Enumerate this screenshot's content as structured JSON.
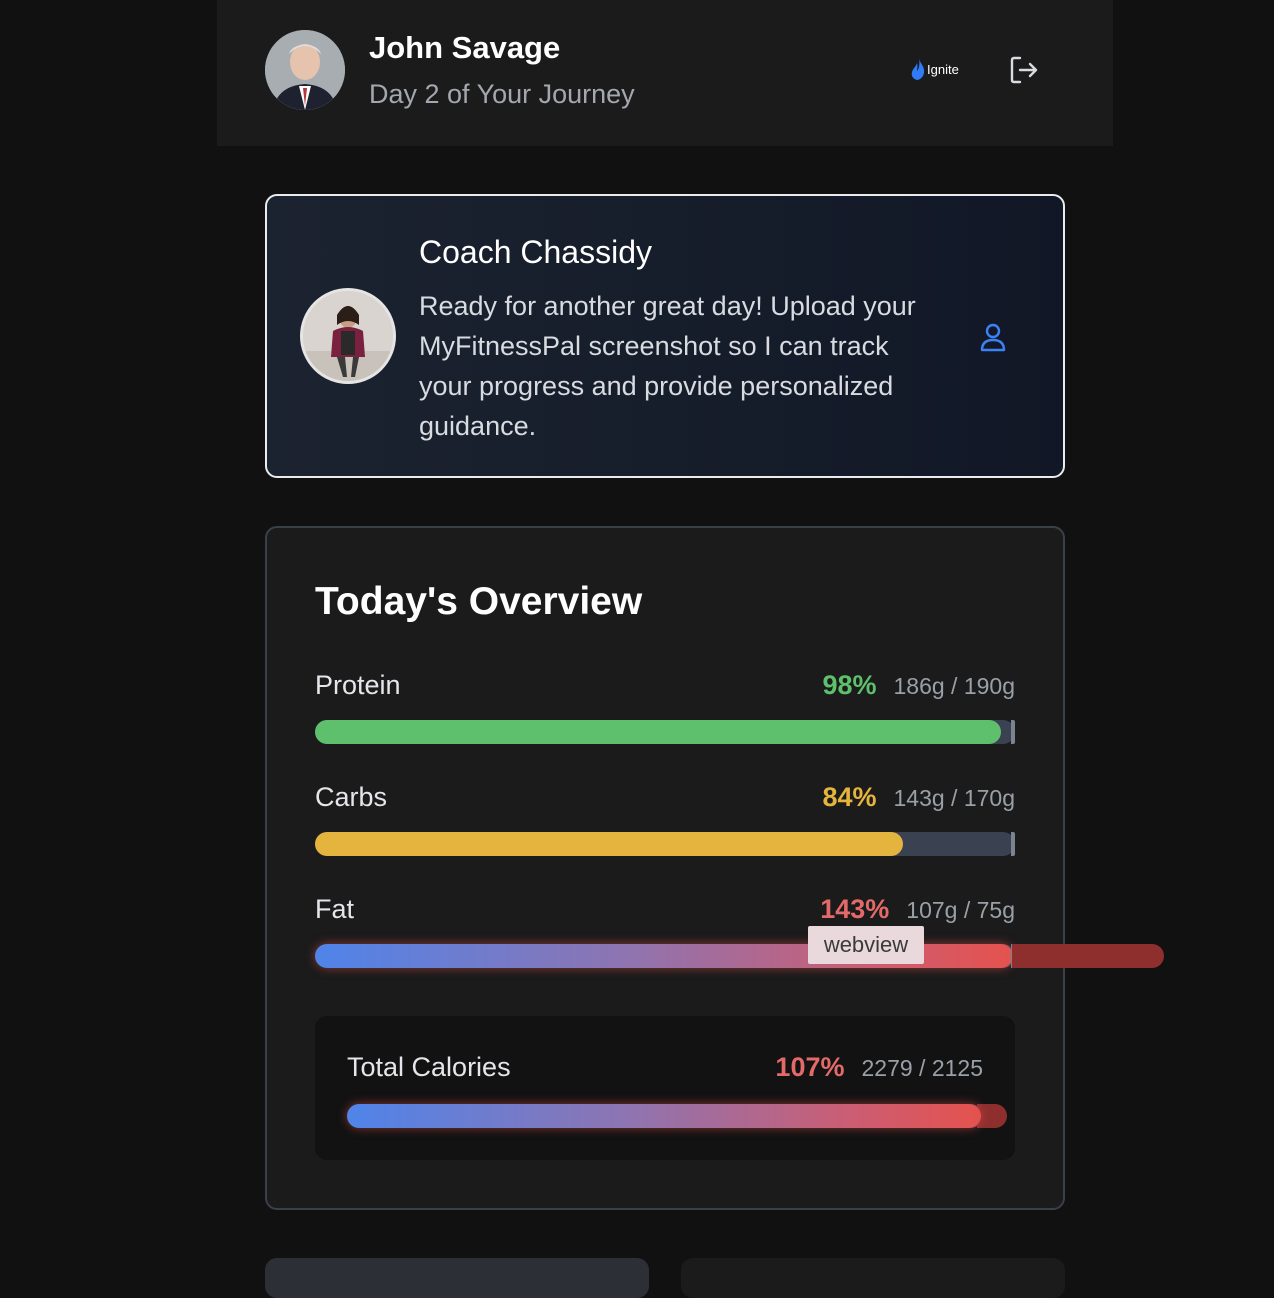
{
  "header": {
    "name": "John Savage",
    "subtitle": "Day 2 of Your Journey",
    "brand_name": "Ignite",
    "brand_icon": "flame-icon",
    "logout_icon": "logout-icon"
  },
  "coach": {
    "name": "Coach Chassidy",
    "message": "Ready for another great day! Upload your MyFitnessPal screenshot so I can track your progress and provide personalized guidance.",
    "profile_icon": "user-icon"
  },
  "overview": {
    "title": "Today's Overview",
    "macros": [
      {
        "label": "Protein",
        "percent": "98%",
        "amount": "186g / 190g",
        "progress": 0.98,
        "color": "#5ec06c"
      },
      {
        "label": "Carbs",
        "percent": "84%",
        "amount": "143g / 170g",
        "progress": 0.84,
        "color": "#e4b43f"
      },
      {
        "label": "Fat",
        "percent": "143%",
        "amount": "107g / 75g",
        "progress": 1.43,
        "color": "#e46a6a"
      }
    ],
    "calories": {
      "label": "Total Calories",
      "percent": "107%",
      "amount": "2279 / 2125",
      "progress": 1.07,
      "color": "#e46a6a"
    }
  },
  "tooltip": {
    "text": "webview"
  }
}
